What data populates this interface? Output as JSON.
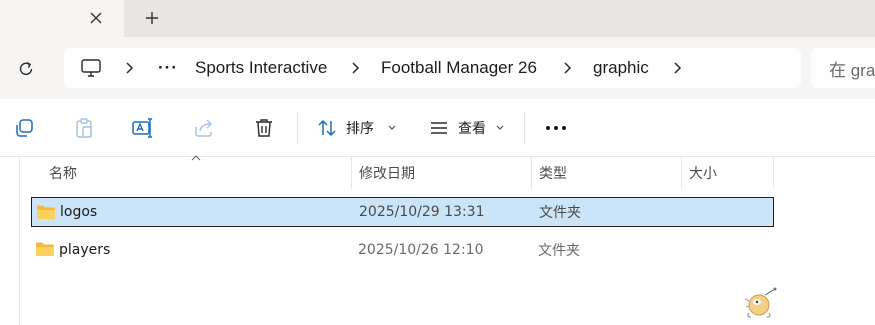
{
  "tabs": {
    "close_glyph": "✕",
    "new_glyph": "+"
  },
  "address": {
    "ellipsis": "···",
    "crumbs": [
      "Sports Interactive",
      "Football Manager 26",
      "graphic"
    ],
    "search_placeholder": "在 gra"
  },
  "toolbar": {
    "sort_label": "排序",
    "view_label": "查看",
    "more_glyph": "···"
  },
  "columns": {
    "name": "名称",
    "modified": "修改日期",
    "type": "类型",
    "size": "大小"
  },
  "files": [
    {
      "name": "logos",
      "modified": "2025/10/29 13:31",
      "type": "文件夹",
      "size": "",
      "selected": true
    },
    {
      "name": "players",
      "modified": "2025/10/26 12:10",
      "type": "文件夹",
      "size": "",
      "selected": false
    }
  ],
  "colors": {
    "accent": "#0067c0",
    "selection": "#cce4f7",
    "folder": "#f9c84a"
  }
}
